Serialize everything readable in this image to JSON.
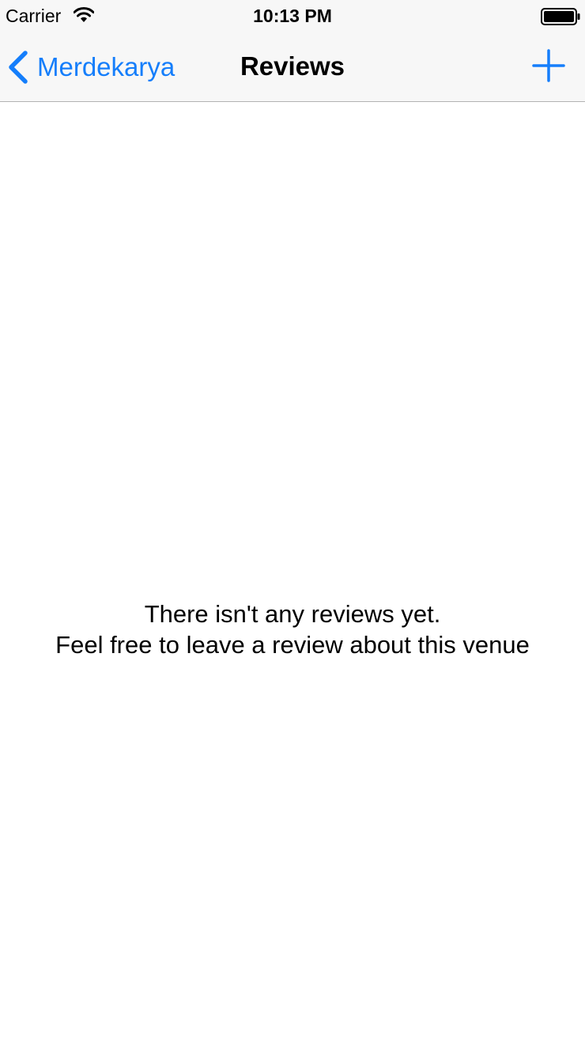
{
  "status_bar": {
    "carrier": "Carrier",
    "time": "10:13 PM",
    "icons": [
      "wifi-icon",
      "battery-icon"
    ]
  },
  "navbar": {
    "back_label": "Merdekarya",
    "title": "Reviews",
    "back_icon": "chevron-left-icon",
    "add_icon": "plus-icon"
  },
  "empty_state": {
    "line1": "There isn't any reviews yet.",
    "line2": "Feel free to leave a review about this venue"
  },
  "colors": {
    "accent": "#157efb",
    "navbar_background": "#f7f7f7",
    "text": "#000000"
  }
}
